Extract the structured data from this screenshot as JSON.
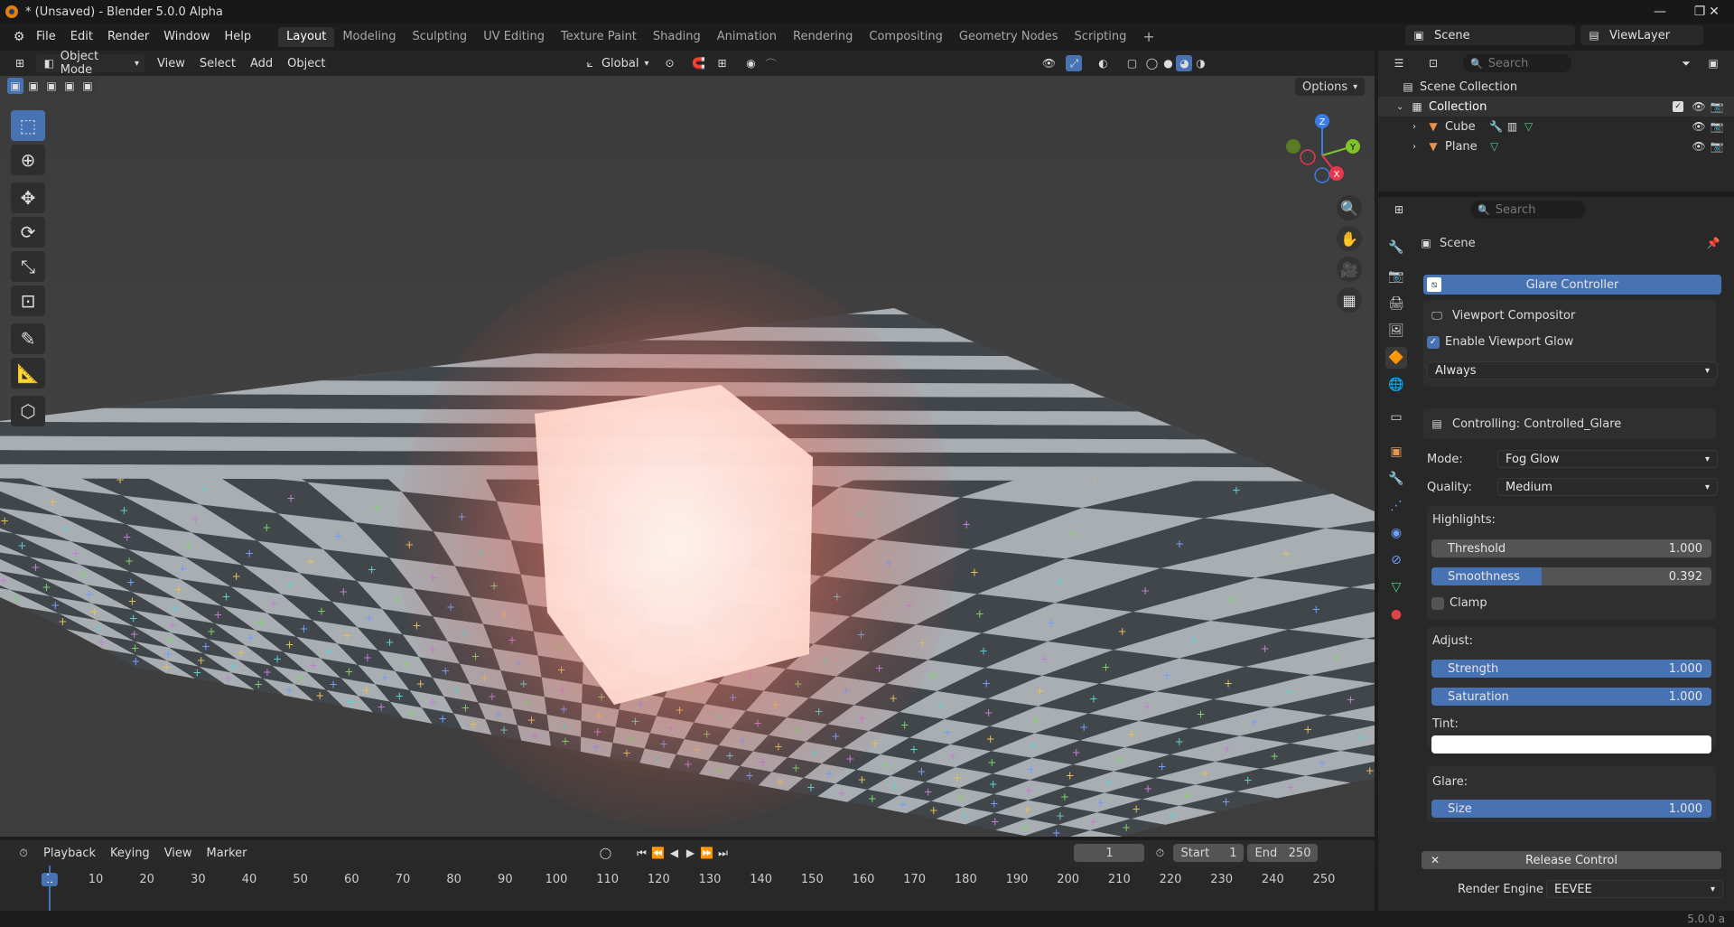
{
  "window": {
    "title": "* (Unsaved) - Blender 5.0.0 Alpha",
    "controls": {
      "minimize": "—",
      "maximize": "❐",
      "close": "✕"
    }
  },
  "menubar": {
    "items": [
      "File",
      "Edit",
      "Render",
      "Window",
      "Help"
    ],
    "workspaces": [
      "Layout",
      "Modeling",
      "Sculpting",
      "UV Editing",
      "Texture Paint",
      "Shading",
      "Animation",
      "Rendering",
      "Compositing",
      "Geometry Nodes",
      "Scripting"
    ],
    "active_workspace": "Layout",
    "add_tab": "+",
    "scene_name": "Scene",
    "view_layer": "ViewLayer"
  },
  "viewport_header": {
    "mode": "Object Mode",
    "menus": [
      "View",
      "Select",
      "Add",
      "Object"
    ],
    "transform_orientation": "Global",
    "options_label": "Options"
  },
  "gizmo": {
    "x": "X",
    "y": "Y",
    "z": "Z"
  },
  "outliner": {
    "search_placeholder": "Search",
    "scene_collection": "Scene Collection",
    "collection": "Collection",
    "objects": [
      "Cube",
      "Plane"
    ]
  },
  "properties": {
    "search_placeholder": "Search",
    "context": "Scene",
    "panel_title": "Glare Controller",
    "viewport_compositor": "Viewport Compositor",
    "enable_glow_label": "Enable Viewport Glow",
    "enable_glow_checked": true,
    "compositor_mode": "Always",
    "controlling": "Controlling: Controlled_Glare",
    "mode_label": "Mode:",
    "mode_value": "Fog Glow",
    "quality_label": "Quality:",
    "quality_value": "Medium",
    "highlights_label": "Highlights:",
    "threshold": {
      "label": "Threshold",
      "value": "1.000",
      "fill": 0.0
    },
    "smoothness": {
      "label": "Smoothness",
      "value": "0.392",
      "fill": 0.392
    },
    "clamp_label": "Clamp",
    "clamp_checked": false,
    "adjust_label": "Adjust:",
    "strength": {
      "label": "Strength",
      "value": "1.000",
      "fill": 1.0
    },
    "saturation": {
      "label": "Saturation",
      "value": "1.000",
      "fill": 1.0
    },
    "tint_label": "Tint:",
    "tint_color": "#ffffff",
    "glare_label": "Glare:",
    "size": {
      "label": "Size",
      "value": "1.000",
      "fill": 1.0
    },
    "release_label": "Release Control",
    "render_engine_label": "Render Engine",
    "render_engine_value": "EEVEE"
  },
  "timeline": {
    "menus": [
      "Playback",
      "Keying",
      "View",
      "Marker"
    ],
    "current_frame": "1",
    "start_label": "Start",
    "start_value": "1",
    "end_label": "End",
    "end_value": "250",
    "ticks": [
      "1",
      "10",
      "20",
      "30",
      "40",
      "50",
      "60",
      "70",
      "80",
      "90",
      "100",
      "110",
      "120",
      "130",
      "140",
      "150",
      "160",
      "170",
      "180",
      "190",
      "200",
      "210",
      "220",
      "230",
      "240",
      "250"
    ]
  },
  "statusbar": {
    "version": "5.0.0 a"
  },
  "colors": {
    "accent": "#4772b3",
    "glow": "#ff9a80"
  }
}
